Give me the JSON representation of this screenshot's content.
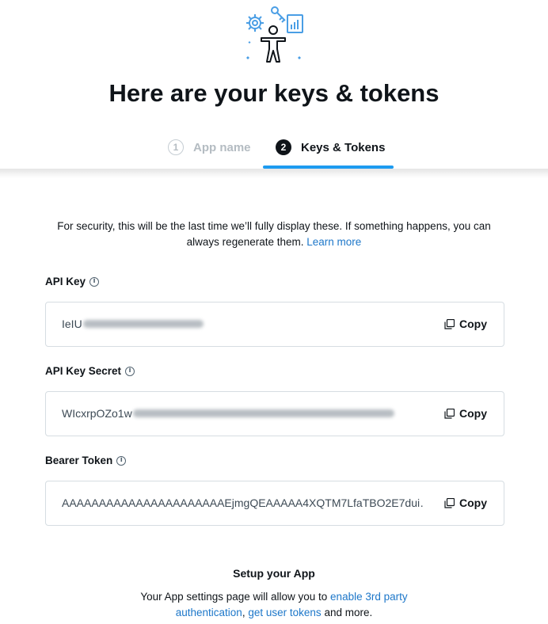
{
  "hero": {
    "icon": "developer-keys-illustration"
  },
  "page": {
    "title": "Here are your keys & tokens"
  },
  "steps": [
    {
      "number": "1",
      "label": "App name",
      "state": "inactive"
    },
    {
      "number": "2",
      "label": "Keys & Tokens",
      "state": "active"
    }
  ],
  "notice": {
    "text": "For security, this will be the last time we’ll fully display these. If something happens, you can always regenerate them.",
    "link": "Learn more"
  },
  "fields": [
    {
      "label": "API Key",
      "value_visible": "IeIU",
      "copy_label": "Copy"
    },
    {
      "label": "API Key Secret",
      "value_visible": "WIcxrpOZo1w",
      "copy_label": "Copy"
    },
    {
      "label": "Bearer Token",
      "value_visible": "AAAAAAAAAAAAAAAAAAAAAAEjmgQEAAAAA4XQTM7LfaTBO2E7dui…",
      "copy_label": "Copy"
    }
  ],
  "setup": {
    "title": "Setup your App",
    "text_before": "Your App settings page will allow you to",
    "link_1": "enable 3rd party authentication",
    "separator": ",",
    "link_2": "get user tokens",
    "text_after": "and more."
  },
  "colors": {
    "accent": "#1d9bf0",
    "link": "#1d77c9",
    "text": "#0f1419",
    "border": "#d6dde2",
    "icon_blue": "#4a9ee5"
  }
}
